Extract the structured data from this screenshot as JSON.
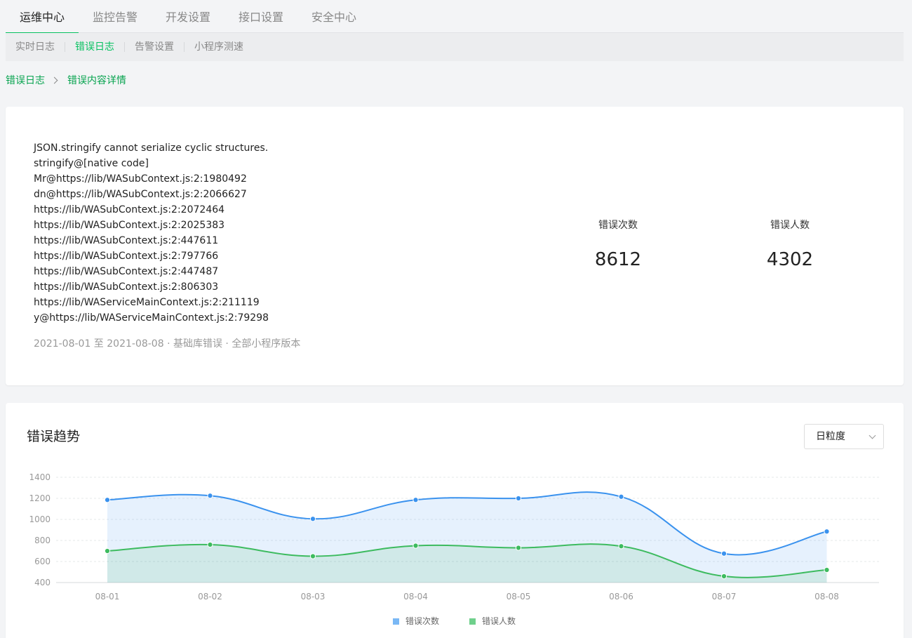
{
  "topnav": {
    "tabs": [
      {
        "label": "运维中心",
        "active": true
      },
      {
        "label": "监控告警",
        "active": false
      },
      {
        "label": "开发设置",
        "active": false
      },
      {
        "label": "接口设置",
        "active": false
      },
      {
        "label": "安全中心",
        "active": false
      }
    ]
  },
  "subnav": {
    "items": [
      {
        "label": "实时日志",
        "active": false
      },
      {
        "label": "错误日志",
        "active": true
      },
      {
        "label": "告警设置",
        "active": false
      },
      {
        "label": "小程序测速",
        "active": false
      }
    ]
  },
  "breadcrumb": {
    "parent": "错误日志",
    "current": "错误内容详情"
  },
  "error_detail": {
    "stack": [
      "JSON.stringify cannot serialize cyclic structures.",
      "stringify@[native code]",
      "Mr@https://lib/WASubContext.js:2:1980492",
      "dn@https://lib/WASubContext.js:2:2066627",
      "https://lib/WASubContext.js:2:2072464",
      "https://lib/WASubContext.js:2:2025383",
      "https://lib/WASubContext.js:2:447611",
      "https://lib/WASubContext.js:2:797766",
      "https://lib/WASubContext.js:2:447487",
      "https://lib/WASubContext.js:2:806303",
      "https://lib/WAServiceMainContext.js:2:211119",
      "y@https://lib/WAServiceMainContext.js:2:79298"
    ],
    "meta": "2021-08-01 至  2021-08-08 ·  基础库错误 ·  全部小程序版本"
  },
  "stats": {
    "error_count_label": "错误次数",
    "error_count": "8612",
    "error_users_label": "错误人数",
    "error_users": "4302"
  },
  "trend": {
    "title": "错误趋势",
    "granularity": "日粒度"
  },
  "colors": {
    "accent": "#07c160",
    "series1": "#3a92ee",
    "series2": "#3dbb5f"
  },
  "chart_data": {
    "type": "area",
    "categories": [
      "08-01",
      "08-02",
      "08-03",
      "08-04",
      "08-05",
      "08-06",
      "08-07",
      "08-08"
    ],
    "series": [
      {
        "name": "错误次数",
        "values": [
          1185,
          1225,
          1005,
          1185,
          1200,
          1215,
          675,
          885
        ]
      },
      {
        "name": "错误人数",
        "values": [
          700,
          760,
          650,
          750,
          730,
          745,
          460,
          520
        ]
      }
    ],
    "ylim": [
      400,
      1400
    ],
    "yticks": [
      400,
      600,
      800,
      1000,
      1200,
      1400
    ],
    "grid": true,
    "legend": "bottom-center"
  }
}
